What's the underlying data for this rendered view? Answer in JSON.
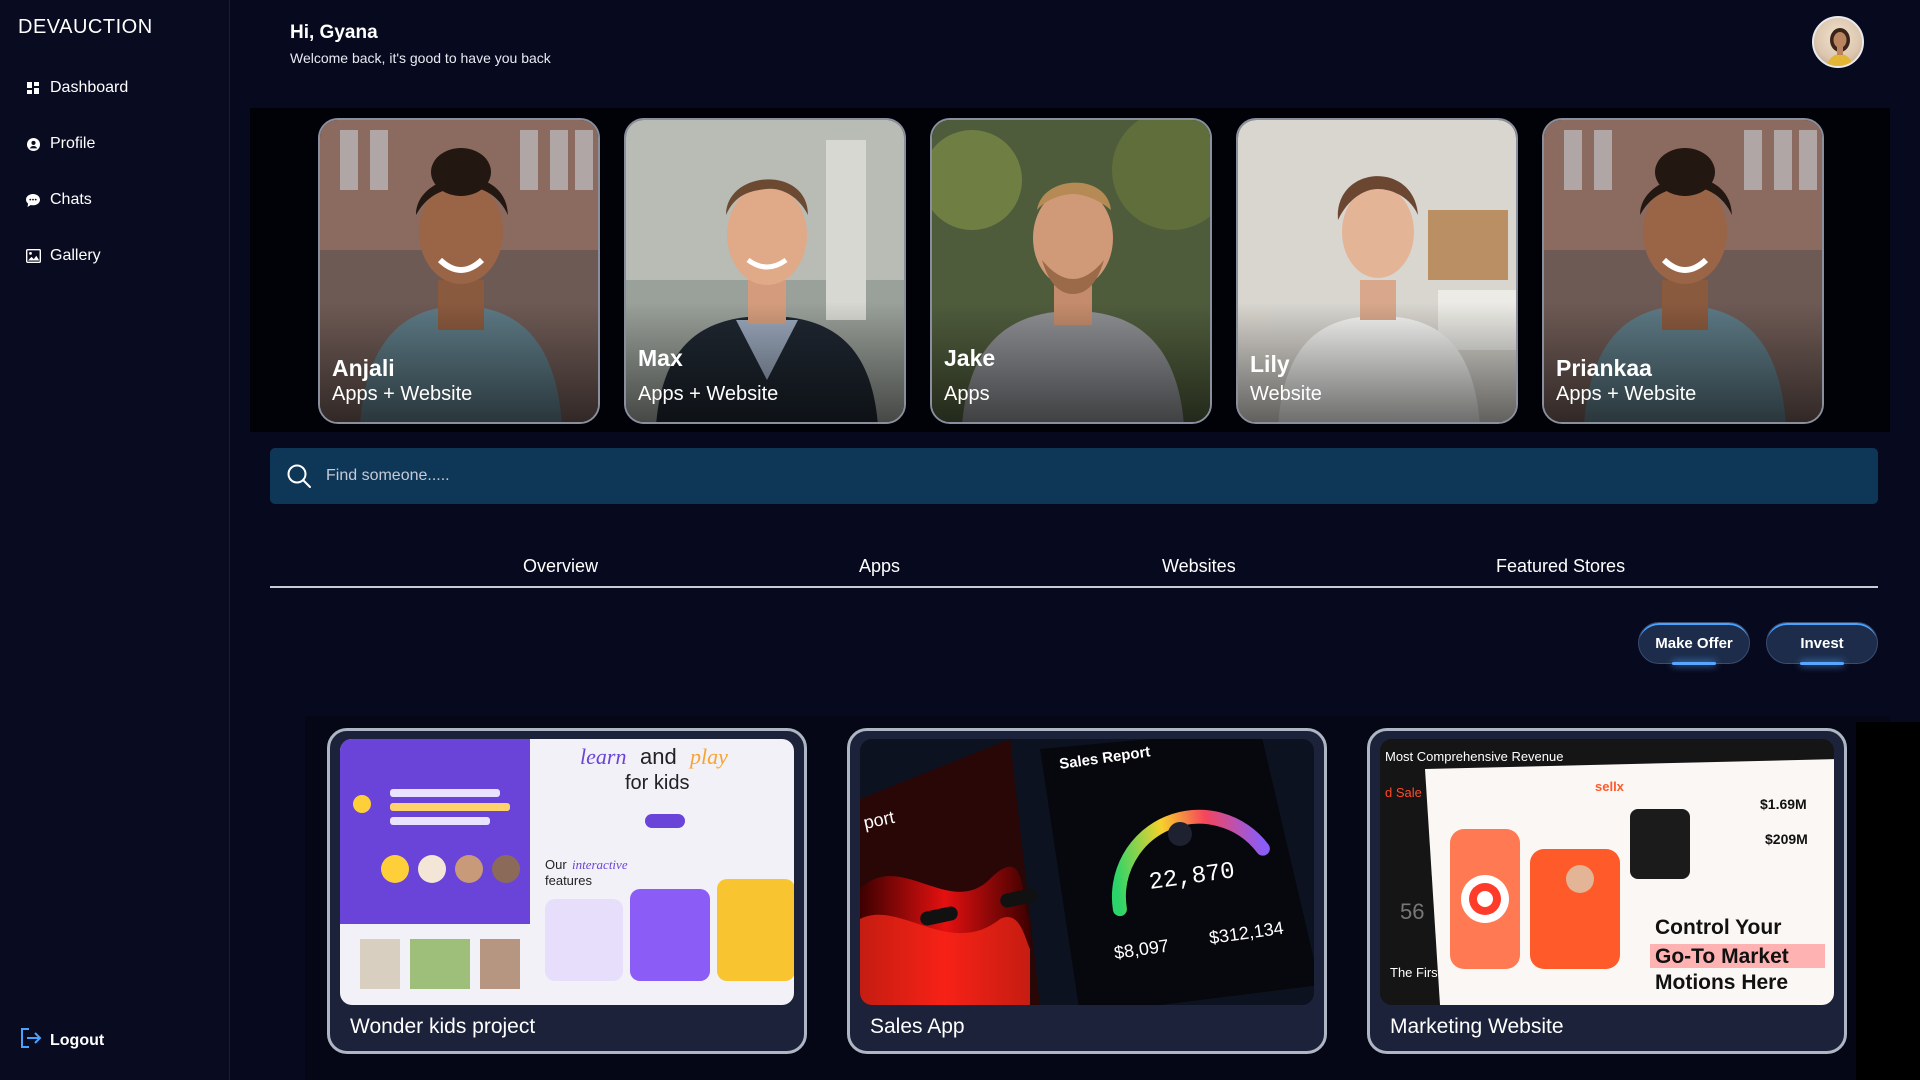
{
  "app": {
    "brand": "DEVAUCTION"
  },
  "sidebar": {
    "items": [
      {
        "label": "Dashboard",
        "icon": "grid-icon"
      },
      {
        "label": "Profile",
        "icon": "user-circle-icon"
      },
      {
        "label": "Chats",
        "icon": "chat-bubble-icon"
      },
      {
        "label": "Gallery",
        "icon": "image-icon"
      }
    ],
    "logout_label": "Logout"
  },
  "header": {
    "greeting": "Hi, Gyana",
    "subtitle": "Welcome back, it's good to have you back"
  },
  "people": [
    {
      "name": "Anjali",
      "role": "Apps + Website"
    },
    {
      "name": "Max",
      "role": "Apps + Website"
    },
    {
      "name": "Jake",
      "role": "Apps"
    },
    {
      "name": "Lily",
      "role": "Website"
    },
    {
      "name": "Priankaa",
      "role": "Apps + Website"
    }
  ],
  "search": {
    "placeholder": "Find someone....."
  },
  "tabs": [
    "Overview",
    "Apps",
    "Websites",
    "Featured Stores"
  ],
  "actions": {
    "make_offer": "Make Offer",
    "invest": "Invest"
  },
  "projects": [
    {
      "title": "Wonder kids project"
    },
    {
      "title": "Sales App"
    },
    {
      "title": "Marketing Website"
    }
  ],
  "colors": {
    "background": "#07091e",
    "search_bg": "#0e3657",
    "accent": "#58a6ff"
  }
}
